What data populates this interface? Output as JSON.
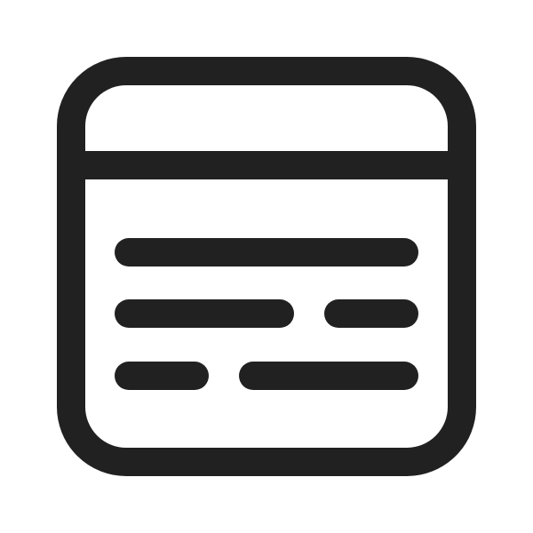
{
  "icon": {
    "name": "document-text-window-icon",
    "stroke_color": "#212121",
    "background_color": "#ffffff"
  }
}
